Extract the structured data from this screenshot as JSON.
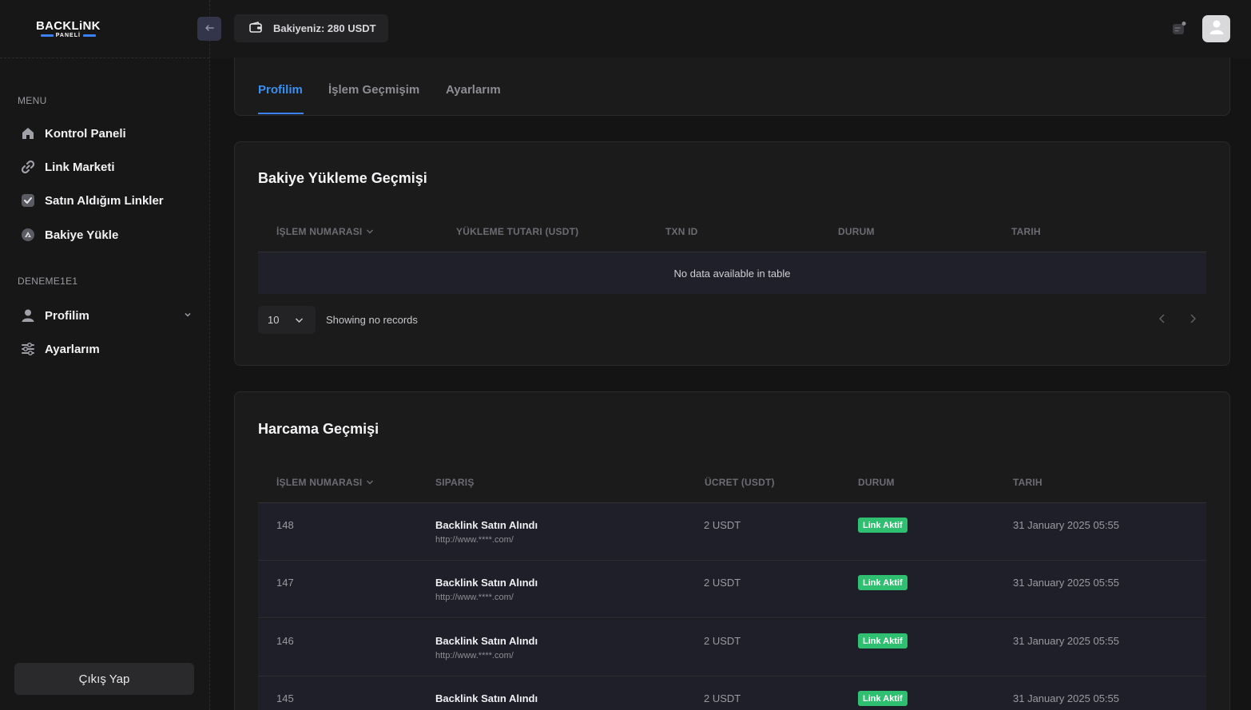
{
  "brand": {
    "word": "BACKLiNK",
    "sub": "PANELİ"
  },
  "sidebar": {
    "menu_title": "MENU",
    "items": [
      {
        "label": "Kontrol Paneli",
        "icon": "home-icon"
      },
      {
        "label": "Link Marketi",
        "icon": "link-icon"
      },
      {
        "label": "Satın Aldığım Linkler",
        "icon": "check-icon"
      },
      {
        "label": "Bakiye Yükle",
        "icon": "upload-icon"
      }
    ],
    "user_title": "DENEME1E1",
    "user_items": [
      {
        "label": "Profilim",
        "icon": "user-icon"
      },
      {
        "label": "Ayarlarım",
        "icon": "sliders-icon"
      }
    ],
    "logout_label": "Çıkış Yap"
  },
  "topbar": {
    "balance_text": "Bakiyeniz: 280 USDT"
  },
  "tabs": [
    {
      "label": "Profilim",
      "active": true
    },
    {
      "label": "İşlem Geçmişim",
      "active": false
    },
    {
      "label": "Ayarlarım",
      "active": false
    }
  ],
  "deposit_history": {
    "title": "Bakiye Yükleme Geçmişi",
    "columns": [
      "İŞLEM NUMARASI",
      "YÜKLEME TUTARI (USDT)",
      "TXN ID",
      "DURUM",
      "TARIH"
    ],
    "empty_text": "No data available in table",
    "page_size": "10",
    "showing_text": "Showing no records"
  },
  "spend_history": {
    "title": "Harcama Geçmişi",
    "columns": [
      "İŞLEM NUMARASI",
      "SIPARIŞ",
      "ÜCRET (USDT)",
      "DURUM",
      "TARIH"
    ],
    "rows": [
      {
        "id": "148",
        "order": "Backlink Satın Alındı",
        "url": "http://www.****.com/",
        "price": "2 USDT",
        "status": "Link Aktif",
        "date": "31 January 2025 05:55"
      },
      {
        "id": "147",
        "order": "Backlink Satın Alındı",
        "url": "http://www.****.com/",
        "price": "2 USDT",
        "status": "Link Aktif",
        "date": "31 January 2025 05:55"
      },
      {
        "id": "146",
        "order": "Backlink Satın Alındı",
        "url": "http://www.****.com/",
        "price": "2 USDT",
        "status": "Link Aktif",
        "date": "31 January 2025 05:55"
      },
      {
        "id": "145",
        "order": "Backlink Satın Alındı",
        "url": "",
        "price": "2 USDT",
        "status": "Link Aktif",
        "date": "31 January 2025 05:55"
      }
    ]
  },
  "colors": {
    "accent": "#3b82f6",
    "success": "#2fbf71",
    "background": "#141414"
  }
}
